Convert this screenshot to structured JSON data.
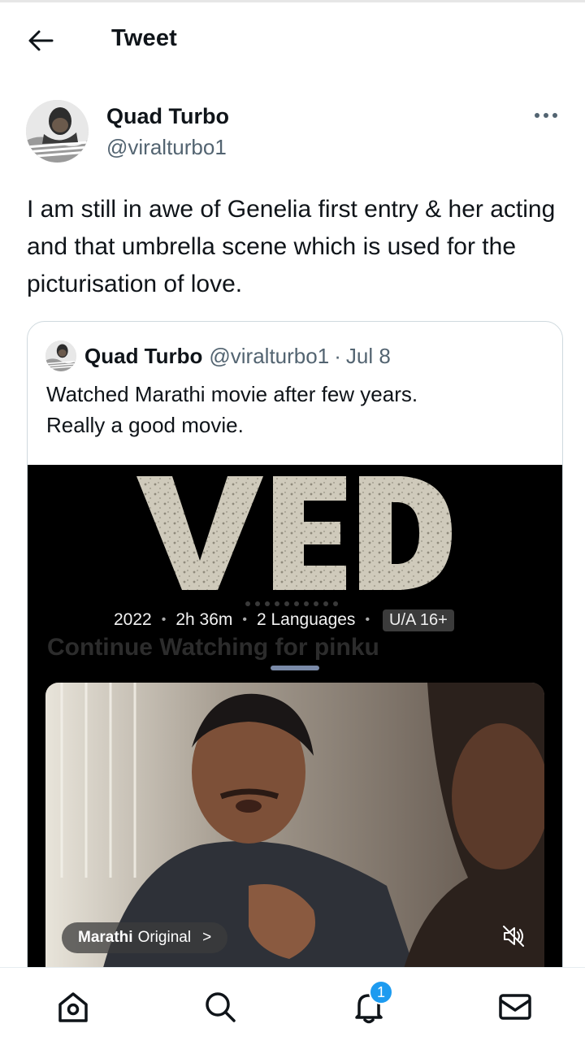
{
  "header": {
    "title": "Tweet",
    "back_icon": "arrow-left-icon"
  },
  "tweet": {
    "author": {
      "name": "Quad Turbo",
      "handle": "@viralturbo1",
      "avatar_icon": "avatar-image"
    },
    "more_icon": "more-horizontal-icon",
    "text": "I am still in awe of Genelia first entry & her acting and that umbrella scene which is used for the picturisation of love."
  },
  "quote": {
    "author_name": "Quad Turbo",
    "author_handle": "@viralturbo1",
    "separator": "·",
    "date": "Jul 8",
    "text_line1": "Watched  Marathi movie after few years.",
    "text_line2": "Really a good movie.",
    "media": {
      "movie_title": "VED",
      "year": "2022",
      "duration": "2h 36m",
      "languages": "2 Languages",
      "rating": "U/A 16+",
      "meta_separator": "•",
      "continue_text": "Continue Watching for pinku",
      "badge_part1": "Marathi",
      "badge_part2": "Original",
      "badge_arrow": ">",
      "mute_icon": "speaker-muted-icon"
    }
  },
  "bottom_nav": {
    "items": [
      {
        "name": "home",
        "icon": "home-icon"
      },
      {
        "name": "search",
        "icon": "search-icon"
      },
      {
        "name": "notifications",
        "icon": "bell-icon"
      },
      {
        "name": "messages",
        "icon": "mail-icon"
      }
    ],
    "notifications_count": "1"
  },
  "colors": {
    "text_primary": "#0f1419",
    "text_secondary": "#536471",
    "accent": "#1d9bf0",
    "border": "#cfd9de"
  }
}
